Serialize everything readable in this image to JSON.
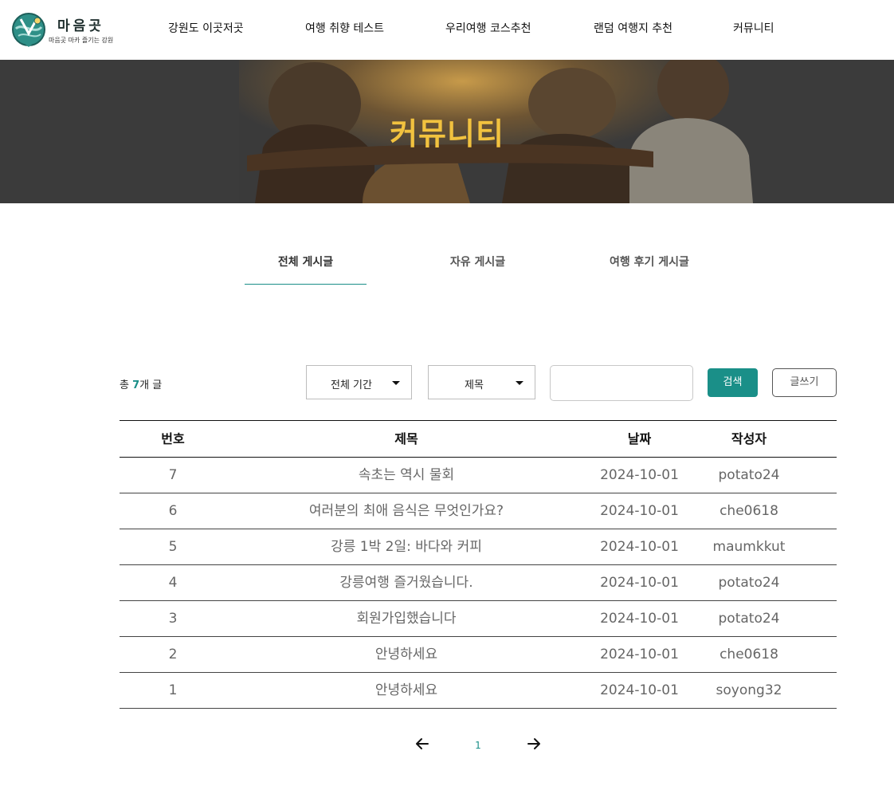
{
  "brand": {
    "name": "마음곳",
    "tagline": "마음곳 마카 즐기는 강원"
  },
  "nav": [
    {
      "label": "강원도 이곳저곳"
    },
    {
      "label": "여행 취향 테스트"
    },
    {
      "label": "우리여행 코스추천"
    },
    {
      "label": "랜덤 여행지 추천"
    },
    {
      "label": "커뮤니티"
    }
  ],
  "hero": {
    "title": "커뮤니티"
  },
  "tabs": [
    {
      "label": "전체 게시글",
      "active": true
    },
    {
      "label": "자유 게시글",
      "active": false
    },
    {
      "label": "여행 후기 게시글",
      "active": false
    }
  ],
  "toolbar": {
    "total_prefix": "총 ",
    "total_count": "7",
    "total_suffix": "개 글",
    "period_select": "전체 기간",
    "field_select": "제목",
    "search_value": "",
    "search_button": "검색",
    "write_button": "글쓰기"
  },
  "table": {
    "headers": {
      "no": "번호",
      "title": "제목",
      "date": "날짜",
      "author": "작성자"
    },
    "rows": [
      {
        "no": "7",
        "title": "속초는 역시 물회",
        "date": "2024-10-01",
        "author": "potato24"
      },
      {
        "no": "6",
        "title": "여러분의 최애 음식은 무엇인가요?",
        "date": "2024-10-01",
        "author": "che0618"
      },
      {
        "no": "5",
        "title": "강릉 1박 2일: 바다와 커피",
        "date": "2024-10-01",
        "author": "maumkkut"
      },
      {
        "no": "4",
        "title": "강릉여행 즐거웠습니다.",
        "date": "2024-10-01",
        "author": "potato24"
      },
      {
        "no": "3",
        "title": "회원가입했습니다",
        "date": "2024-10-01",
        "author": "potato24"
      },
      {
        "no": "2",
        "title": "안녕하세요",
        "date": "2024-10-01",
        "author": "che0618"
      },
      {
        "no": "1",
        "title": "안녕하세요",
        "date": "2024-10-01",
        "author": "soyong32"
      }
    ]
  },
  "pagination": {
    "current_page": "1"
  },
  "colors": {
    "accent": "#1a8f88",
    "hero_title": "#f2c23f",
    "hero_bg": "#3a3a3a"
  }
}
